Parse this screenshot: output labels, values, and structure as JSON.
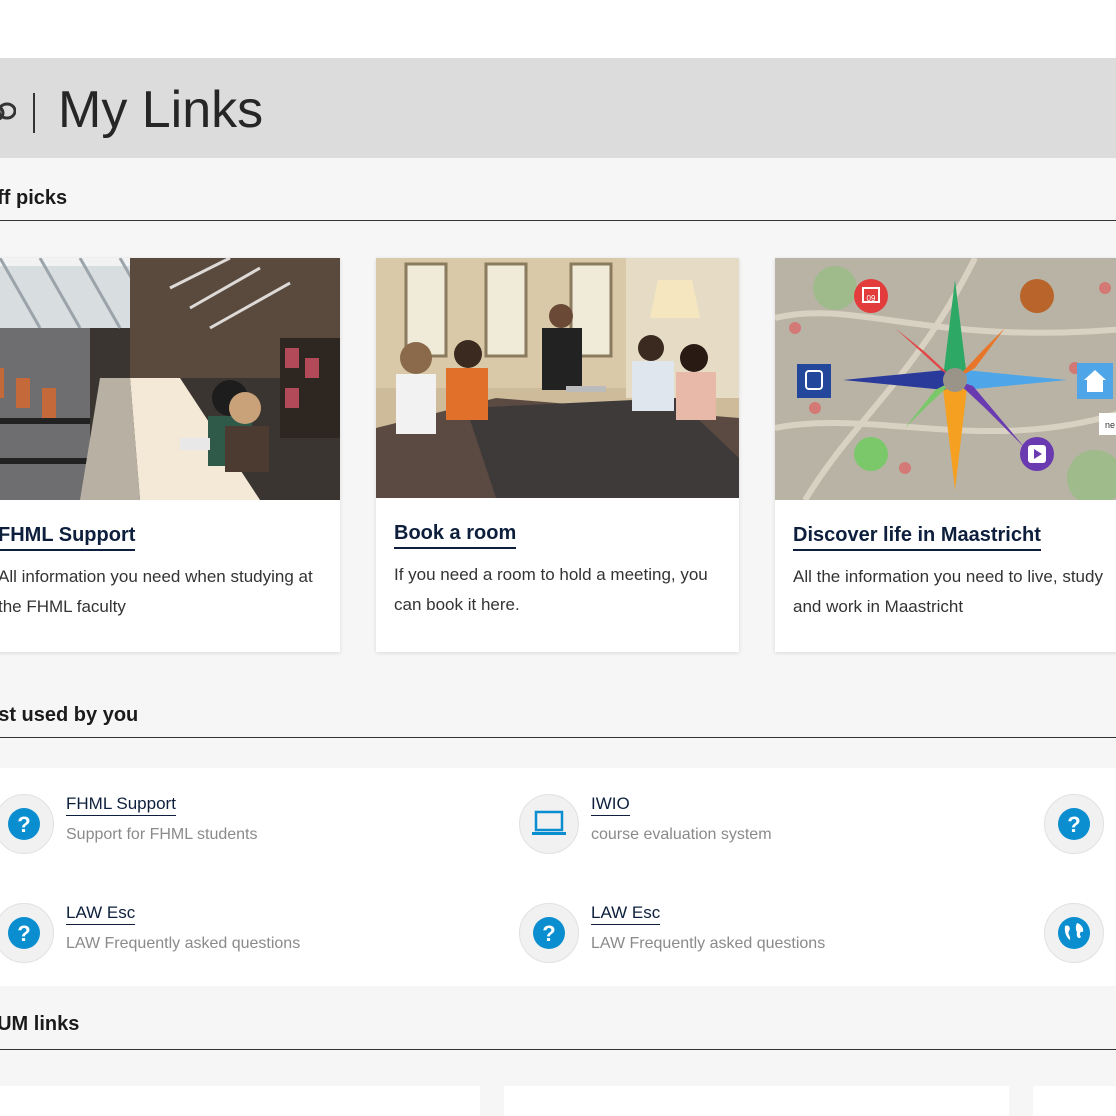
{
  "header": {
    "title": "My Links",
    "separator": "|"
  },
  "sections": {
    "staff_picks": "aff picks",
    "most_used": "ost used by you",
    "all_links": "l UM links"
  },
  "cards": [
    {
      "title": "FHML Support",
      "description": "All information you need when studying at the FHML faculty"
    },
    {
      "title": "Book a room",
      "description": "If you need a room to hold a meeting, you can book it here."
    },
    {
      "title": "Discover life in Maastricht",
      "description": "All the information you need to live, study and work in Maastricht"
    }
  ],
  "most_used": [
    {
      "title": "FHML Support",
      "description": "Support for FHML students",
      "icon": "question-icon"
    },
    {
      "title": "IWIO",
      "description": "course evaluation system",
      "icon": "laptop-icon"
    },
    {
      "title": "",
      "description": "",
      "icon": "question-icon"
    },
    {
      "title": "LAW Esc",
      "description": "LAW Frequently asked questions",
      "icon": "question-icon"
    },
    {
      "title": "LAW Esc",
      "description": "LAW Frequently asked questions",
      "icon": "question-icon"
    },
    {
      "title": "",
      "description": "",
      "icon": "globe-icon"
    }
  ],
  "map_labels": {
    "calendar_day": "09",
    "edge_tag": "ne"
  },
  "colors": {
    "accent_blue": "#0a8ed0",
    "link_navy": "#0d1f3c",
    "title_bar_gray": "#dcdcdc"
  }
}
